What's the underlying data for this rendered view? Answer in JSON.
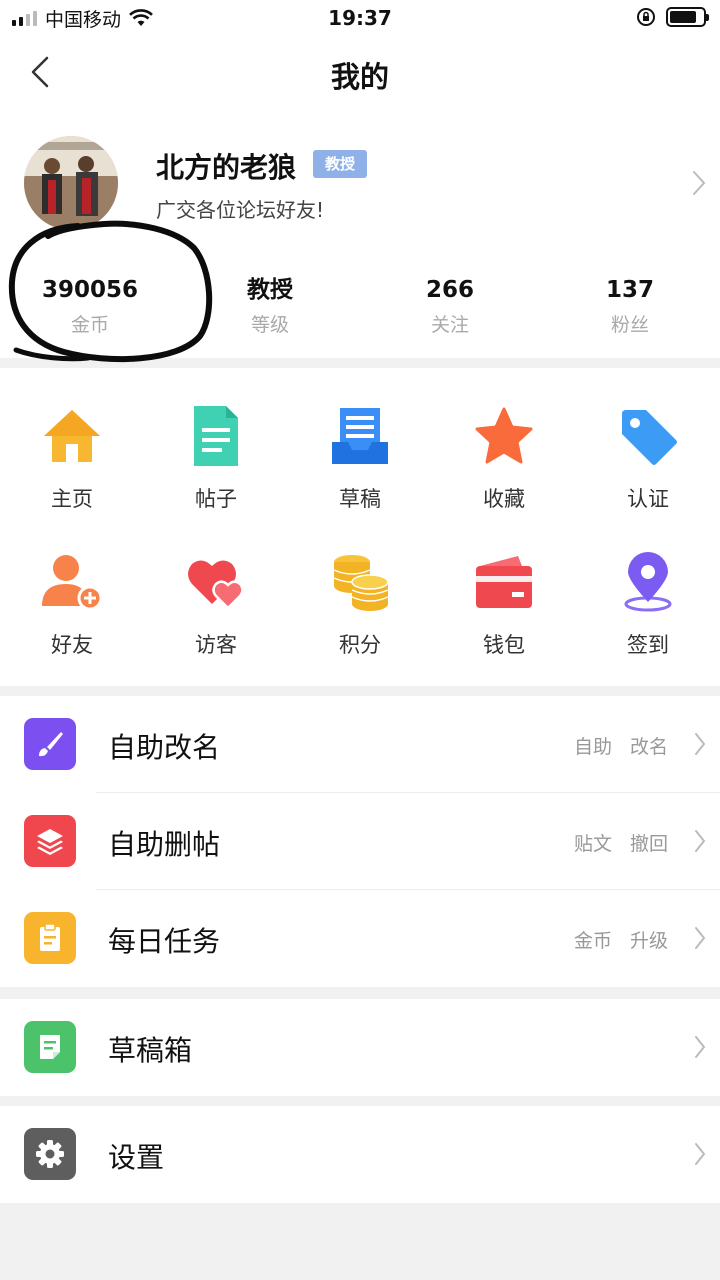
{
  "status_bar": {
    "carrier": "中国移动",
    "time": "19:37"
  },
  "nav": {
    "title": "我的"
  },
  "profile": {
    "name": "北方的老狼",
    "badge": "教授",
    "signature": "广交各位论坛好友!",
    "stats": [
      {
        "value": "390056",
        "label": "金币"
      },
      {
        "value": "教授",
        "label": "等级"
      },
      {
        "value": "266",
        "label": "关注"
      },
      {
        "value": "137",
        "label": "粉丝"
      }
    ]
  },
  "grid": {
    "items": [
      {
        "label": "主页",
        "icon": "home-icon"
      },
      {
        "label": "帖子",
        "icon": "document-icon"
      },
      {
        "label": "草稿",
        "icon": "draft-tray-icon"
      },
      {
        "label": "收藏",
        "icon": "star-icon"
      },
      {
        "label": "认证",
        "icon": "tag-icon"
      },
      {
        "label": "好友",
        "icon": "add-friend-icon"
      },
      {
        "label": "访客",
        "icon": "hearts-icon"
      },
      {
        "label": "积分",
        "icon": "coins-icon"
      },
      {
        "label": "钱包",
        "icon": "wallet-icon"
      },
      {
        "label": "签到",
        "icon": "location-pin-icon"
      }
    ]
  },
  "list": {
    "group1": [
      {
        "title": "自助改名",
        "sub": [
          "自助",
          "改名"
        ],
        "icon": "brush-icon",
        "color": "#7b4ff0"
      },
      {
        "title": "自助删帖",
        "sub": [
          "贴文",
          "撤回"
        ],
        "icon": "layers-icon",
        "color": "#f0474f"
      },
      {
        "title": "每日任务",
        "sub": [
          "金币",
          "升级"
        ],
        "icon": "clipboard-icon",
        "color": "#f7b42c"
      }
    ],
    "group2": [
      {
        "title": "草稿箱",
        "icon": "draft-note-icon",
        "color": "#4cc26a"
      }
    ],
    "group3": [
      {
        "title": "设置",
        "icon": "gear-icon",
        "color": "#5e5e5e"
      }
    ]
  }
}
